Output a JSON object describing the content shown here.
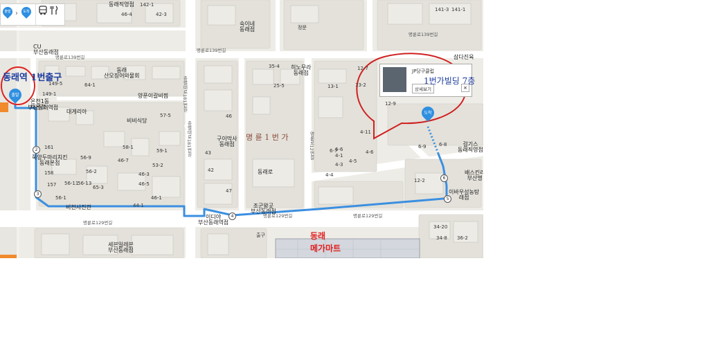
{
  "controls": {
    "start_label": "출발",
    "end_label": "도착",
    "separator": "›",
    "bus_icon": "bus-icon",
    "food_icon": "fork-knife-icon"
  },
  "pins": {
    "start": "출발",
    "end": "도착"
  },
  "route_numbers": [
    "2",
    "3",
    "4",
    "5",
    "6"
  ],
  "info_window": {
    "title": "JP당구클럽",
    "detail_button": "상세보기",
    "close_symbol": "×"
  },
  "annotations": {
    "exit_label": "동래역 1번출구",
    "building_label": "1번가빌딩 7층",
    "district_label": "명 륜 1 번 가",
    "megamart_line1": "동래",
    "megamart_line2": "메가마트"
  },
  "roads": {
    "top_road": "명륜로139번길",
    "top_road_b": "명륜로139번길",
    "top_road_c": "명륜로139번길",
    "bottom_road": "명륜로129번길",
    "bottom_road_b": "명륜로129번길",
    "middle_road": "명륜로129번길",
    "vertical_a": "충렬대로181번길",
    "vertical_b": "충렬대로181번길",
    "vertical_c": "명륜로12번길"
  },
  "places": [
    {
      "name": "CU\n부산동래점"
    },
    {
      "name": "숙이네\n동래점"
    },
    {
      "name": "동래\n산오징어와물회"
    },
    {
      "name": "양푼이갈비찜"
    },
    {
      "name": "대게리아"
    },
    {
      "name": "비비식당"
    },
    {
      "name": "히노무라\n동래점"
    },
    {
      "name": "구이막사\n동래점"
    },
    {
      "name": "동래로"
    },
    {
      "name": "쭉양두마리치킨\n동래본점"
    },
    {
      "name": "온천1동\n래온천"
    },
    {
      "name": "부산동래역점"
    },
    {
      "name": "비천사진관"
    },
    {
      "name": "이디야\n부산동래역점"
    },
    {
      "name": "조군왕곳\n부산동래점"
    },
    {
      "name": "세븐일레븐\n부산동래점"
    },
    {
      "name": "삼다진육"
    },
    {
      "name": "걸기스\n동래직영점"
    },
    {
      "name": "배스킨라\n부산명"
    },
    {
      "name": "이바우성농탕\n래점"
    },
    {
      "name": "동래직영점"
    },
    {
      "name": "정문"
    },
    {
      "name": "출구"
    }
  ],
  "lot_numbers": [
    "149-1",
    "149-5",
    "141-3",
    "141-1",
    "142-1",
    "42-3",
    "46-4",
    "25-5",
    "35-4",
    "4-1",
    "4-3",
    "4-4",
    "4-6",
    "4-5",
    "4-11",
    "6-6",
    "6-7",
    "6-8",
    "6-9",
    "12-2",
    "12-7",
    "12-9",
    "13-1",
    "13-2",
    "34-20",
    "34-8",
    "36-2",
    "56-2",
    "56-11",
    "56-13",
    "56-9",
    "56-1",
    "44-1",
    "46-1",
    "46-3",
    "46-5",
    "46-7",
    "53-2",
    "57-5",
    "58-1",
    "59-1",
    "64-1",
    "65-3",
    "42",
    "46",
    "43",
    "47",
    "157",
    "158",
    "161"
  ],
  "colors": {
    "route": "#3b8fe0",
    "annotation_red": "#e02020",
    "annotation_blue": "#1a3aa0",
    "pin": "#2f8fe0"
  }
}
